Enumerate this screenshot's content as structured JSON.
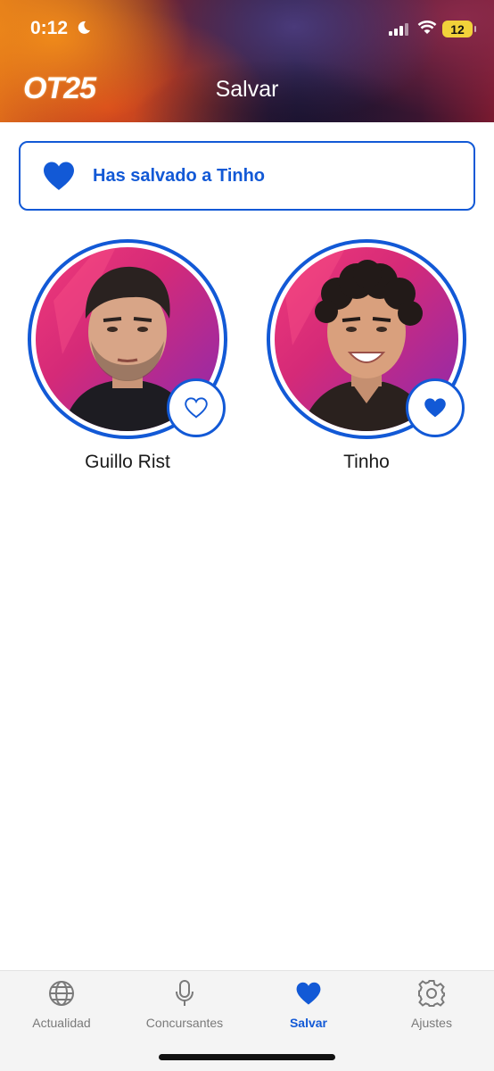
{
  "status_bar": {
    "time": "0:12",
    "battery": "12"
  },
  "header": {
    "logo": "OT25",
    "title": "Salvar"
  },
  "banner": {
    "text": "Has salvado a Tinho"
  },
  "contestants": [
    {
      "name": "Guillo Rist",
      "saved": false
    },
    {
      "name": "Tinho",
      "saved": true
    }
  ],
  "tabs": [
    {
      "label": "Actualidad",
      "icon": "globe-icon",
      "active": false
    },
    {
      "label": "Concursantes",
      "icon": "microphone-icon",
      "active": false
    },
    {
      "label": "Salvar",
      "icon": "heart-icon",
      "active": true
    },
    {
      "label": "Ajustes",
      "icon": "gear-icon",
      "active": false
    }
  ],
  "colors": {
    "accent": "#1259d6",
    "inactive": "#7a7a7a"
  }
}
